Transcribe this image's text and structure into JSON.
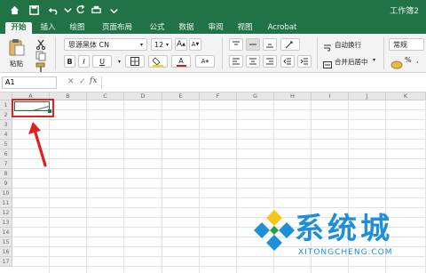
{
  "app": {
    "workbook_title": "工作簿2"
  },
  "tabs": [
    {
      "label": "开始",
      "active": true
    },
    {
      "label": "插入"
    },
    {
      "label": "绘图"
    },
    {
      "label": "页面布局"
    },
    {
      "label": "公式"
    },
    {
      "label": "数据"
    },
    {
      "label": "审阅"
    },
    {
      "label": "视图"
    },
    {
      "label": "Acrobat"
    }
  ],
  "ribbon": {
    "paste_label": "粘贴",
    "font_name": "思源黑体 CN",
    "font_size": "12",
    "bold": "B",
    "italic": "I",
    "underline": "U",
    "wrap_text": "自动换行",
    "merge_center": "合并后居中",
    "number_format": "常规",
    "grow_font": "A",
    "shrink_font": "A",
    "font_color_letter": "A",
    "clear_format_letter": "A"
  },
  "formula_bar": {
    "name_box": "A1",
    "fx": "fx"
  },
  "columns": [
    "A",
    "B",
    "C",
    "D",
    "E",
    "F",
    "G",
    "H",
    "I",
    "J",
    "K"
  ],
  "rows": [
    "1",
    "2",
    "3",
    "4",
    "5",
    "6",
    "7",
    "8",
    "9",
    "10",
    "11",
    "12",
    "13",
    "14",
    "15",
    "16",
    "17"
  ],
  "watermark": {
    "title": "系统城",
    "subtitle": "XITONGCHENG.COM"
  },
  "colors": {
    "excel_green": "#217346",
    "highlight_red": "#e02020",
    "watermark_blue": "#1d8fd8"
  }
}
